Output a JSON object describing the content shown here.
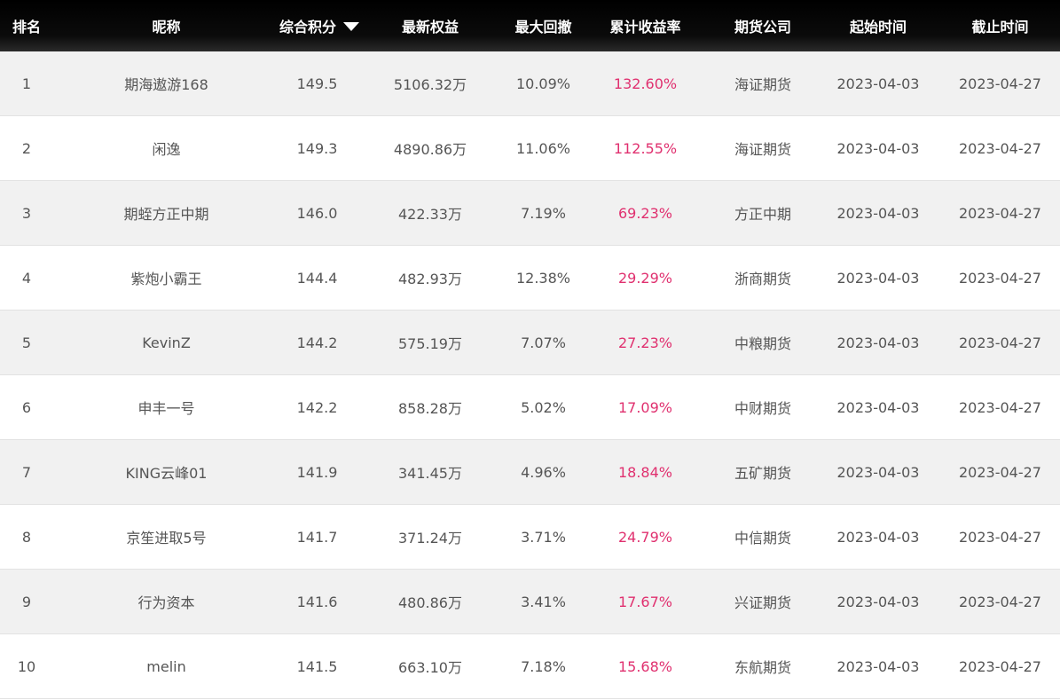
{
  "header": {
    "rank": "排名",
    "name": "昵称",
    "score": "综合积分",
    "equity": "最新权益",
    "drawdown": "最大回撤",
    "return": "累计收益率",
    "firm": "期货公司",
    "start": "起始时间",
    "end": "截止时间",
    "sort_icon": "caret-down-icon"
  },
  "colors": {
    "header_bg": "#000000",
    "odd_row_bg": "#f1f1f1",
    "even_row_bg": "#ffffff",
    "return_color": "#e0306f",
    "text_color": "#555555"
  },
  "rows": [
    {
      "rank": "1",
      "name": "期海遨游168",
      "score": "149.5",
      "equity": "5106.32万",
      "drawdown": "10.09%",
      "return": "132.60%",
      "firm": "海证期货",
      "start": "2023-04-03",
      "end": "2023-04-27"
    },
    {
      "rank": "2",
      "name": "闲逸",
      "score": "149.3",
      "equity": "4890.86万",
      "drawdown": "11.06%",
      "return": "112.55%",
      "firm": "海证期货",
      "start": "2023-04-03",
      "end": "2023-04-27"
    },
    {
      "rank": "3",
      "name": "期蛭方正中期",
      "score": "146.0",
      "equity": "422.33万",
      "drawdown": "7.19%",
      "return": "69.23%",
      "firm": "方正中期",
      "start": "2023-04-03",
      "end": "2023-04-27"
    },
    {
      "rank": "4",
      "name": "紫炮小霸王",
      "score": "144.4",
      "equity": "482.93万",
      "drawdown": "12.38%",
      "return": "29.29%",
      "firm": "浙商期货",
      "start": "2023-04-03",
      "end": "2023-04-27"
    },
    {
      "rank": "5",
      "name": "KevinZ",
      "score": "144.2",
      "equity": "575.19万",
      "drawdown": "7.07%",
      "return": "27.23%",
      "firm": "中粮期货",
      "start": "2023-04-03",
      "end": "2023-04-27"
    },
    {
      "rank": "6",
      "name": "申丰一号",
      "score": "142.2",
      "equity": "858.28万",
      "drawdown": "5.02%",
      "return": "17.09%",
      "firm": "中财期货",
      "start": "2023-04-03",
      "end": "2023-04-27"
    },
    {
      "rank": "7",
      "name": "KING云峰01",
      "score": "141.9",
      "equity": "341.45万",
      "drawdown": "4.96%",
      "return": "18.84%",
      "firm": "五矿期货",
      "start": "2023-04-03",
      "end": "2023-04-27"
    },
    {
      "rank": "8",
      "name": "京笙进取5号",
      "score": "141.7",
      "equity": "371.24万",
      "drawdown": "3.71%",
      "return": "24.79%",
      "firm": "中信期货",
      "start": "2023-04-03",
      "end": "2023-04-27"
    },
    {
      "rank": "9",
      "name": "行为资本",
      "score": "141.6",
      "equity": "480.86万",
      "drawdown": "3.41%",
      "return": "17.67%",
      "firm": "兴证期货",
      "start": "2023-04-03",
      "end": "2023-04-27"
    },
    {
      "rank": "10",
      "name": "melin",
      "score": "141.5",
      "equity": "663.10万",
      "drawdown": "7.18%",
      "return": "15.68%",
      "firm": "东航期货",
      "start": "2023-04-03",
      "end": "2023-04-27"
    }
  ]
}
